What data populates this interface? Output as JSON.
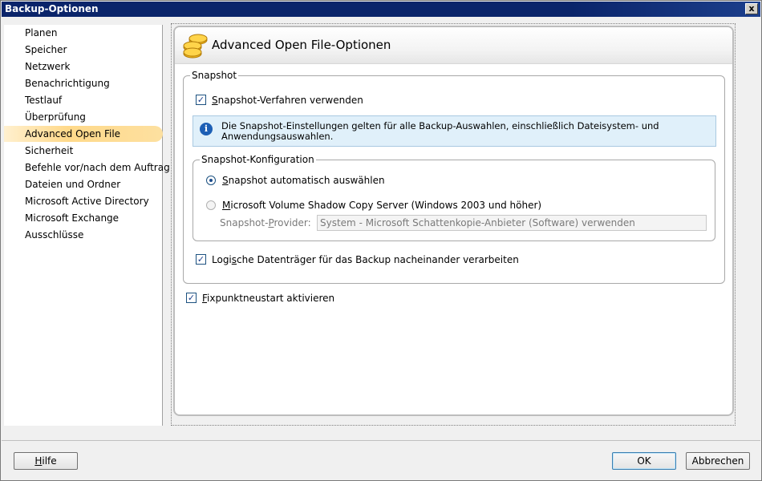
{
  "window": {
    "title": "Backup-Optionen",
    "close_symbol": "x"
  },
  "sidebar": {
    "items": [
      {
        "label": "Planen"
      },
      {
        "label": "Speicher"
      },
      {
        "label": "Netzwerk"
      },
      {
        "label": "Benachrichtigung"
      },
      {
        "label": "Testlauf"
      },
      {
        "label": "Überprüfung"
      },
      {
        "label": "Advanced Open File",
        "active": true
      },
      {
        "label": "Sicherheit"
      },
      {
        "label": "Befehle vor/nach dem Auftrag"
      },
      {
        "label": "Dateien und Ordner"
      },
      {
        "label": "Microsoft Active Directory"
      },
      {
        "label": "Microsoft Exchange"
      },
      {
        "label": "Ausschlüsse"
      }
    ]
  },
  "header": {
    "title": "Advanced Open File-Optionen",
    "icon": "coins-icon"
  },
  "snapshot_group": {
    "label": "Snapshot",
    "use_snapshot": {
      "first": "S",
      "rest": "napshot-Verfahren verwenden",
      "checked": true
    },
    "info": {
      "icon": "info-icon",
      "line1": "Die Snapshot-Einstellungen gelten für alle Backup-Auswahlen, einschließlich Dateisystem- und",
      "line2": "Anwendungsauswahlen."
    },
    "config_group": {
      "label": "Snapshot-Konfiguration",
      "auto_select": {
        "first": "S",
        "rest": "napshot automatisch auswählen",
        "selected": true
      },
      "vss": {
        "first": "M",
        "rest": "icrosoft Volume Shadow Copy Server (Windows 2003 und höher)",
        "selected": false
      },
      "provider_label_pre": "Snapshot-",
      "provider_label_u": "P",
      "provider_label_post": "rovider:",
      "provider_value": "System - Microsoft Schattenkopie-Anbieter (Software) verwenden"
    },
    "logical_drives": {
      "pre": "Logi",
      "u": "s",
      "post": "che Datenträger für das Backup nacheinander verarbeiten",
      "checked": true
    }
  },
  "checkpoint_restart": {
    "first": "F",
    "rest": "ixpunktneustart aktivieren",
    "checked": true
  },
  "footer": {
    "help": {
      "first": "H",
      "rest": "ilfe"
    },
    "ok_label": "OK",
    "cancel_label": "Abbrechen"
  },
  "colors": {
    "titlebar": "#0a246a",
    "active_nav": "#ffd98a",
    "info_bg": "#e0f0fa"
  }
}
